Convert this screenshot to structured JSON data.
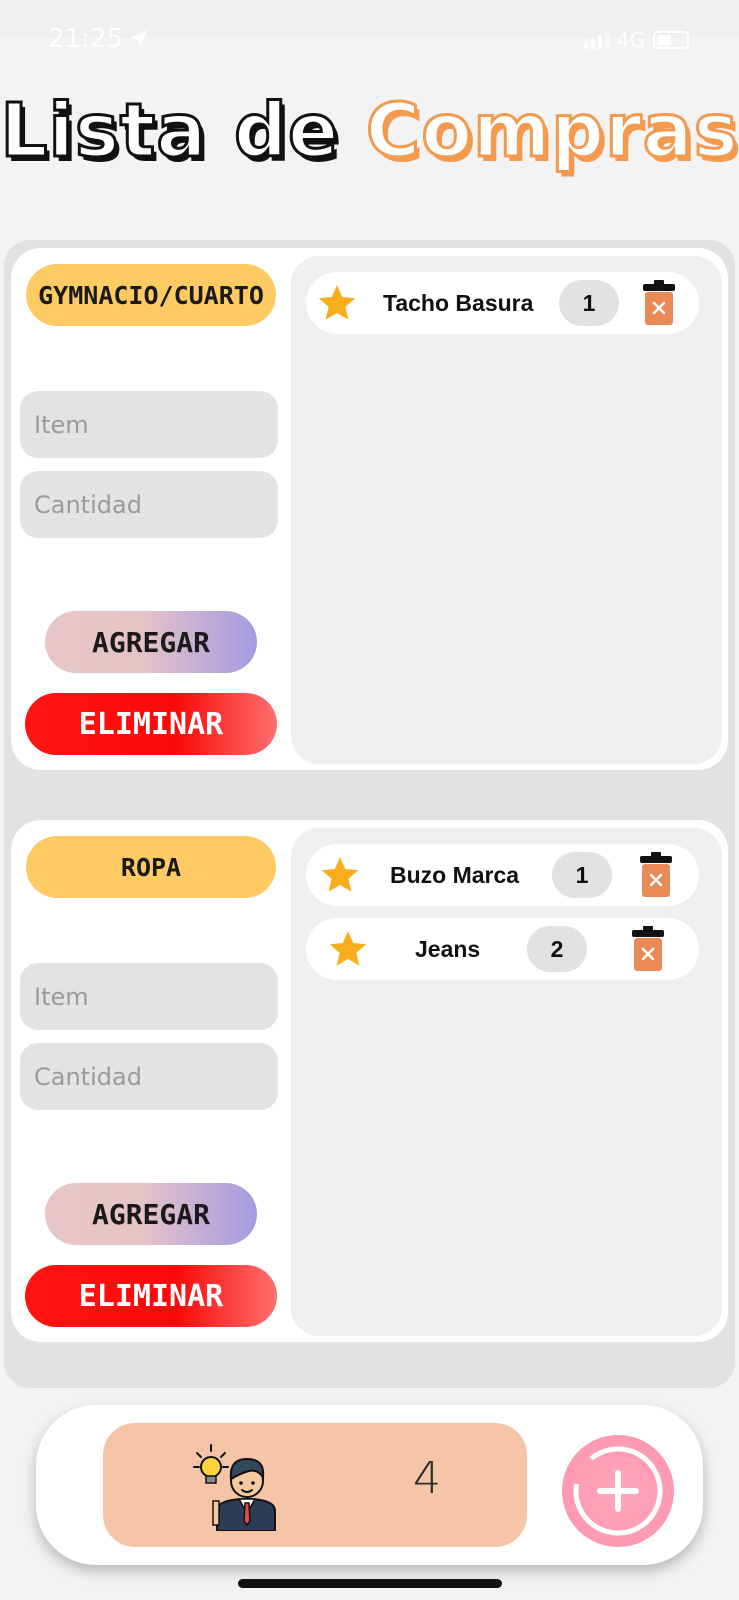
{
  "status_bar": {
    "time": "21:25",
    "network": "4G"
  },
  "header": {
    "title_part1": "Lista de",
    "title_part2": "Compras"
  },
  "lists": [
    {
      "category": "GYMNACIO/CUARTO",
      "item_placeholder": "Item",
      "quantity_placeholder": "Cantidad",
      "add_label": "AGREGAR",
      "delete_label": "ELIMINAR",
      "items": [
        {
          "name": "Tacho Basura",
          "quantity": "1"
        }
      ]
    },
    {
      "category": "ROPA",
      "item_placeholder": "Item",
      "quantity_placeholder": "Cantidad",
      "add_label": "AGREGAR",
      "delete_label": "ELIMINAR",
      "items": [
        {
          "name": "Buzo Marca",
          "quantity": "1"
        },
        {
          "name": "Jeans",
          "quantity": "2"
        }
      ]
    }
  ],
  "bottom_bar": {
    "counter": "4",
    "mascot_icon": "businessman-idea-icon",
    "add_icon": "plus-circle-icon"
  },
  "colors": {
    "accent_orange": "#f39a4f",
    "category_yellow": "#fdca63",
    "delete_red": "#ff1313",
    "trash_orange": "#e98a56",
    "star_gold": "#f8ad1c",
    "counter_bg": "#f6c5a8",
    "fab_pink": "#ff9db5"
  }
}
